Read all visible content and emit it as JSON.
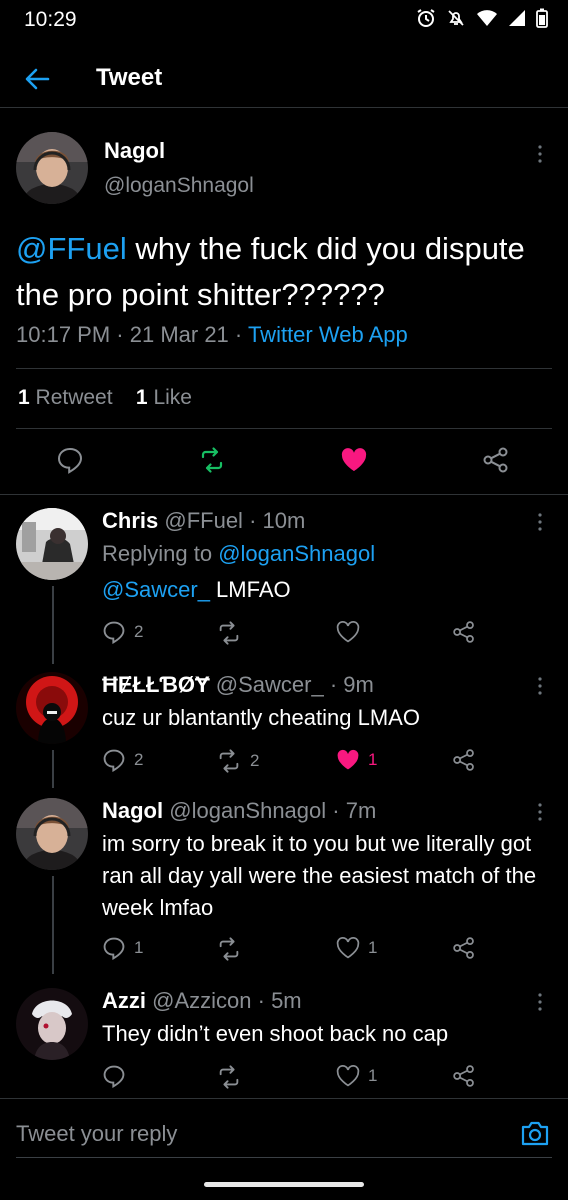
{
  "status_bar": {
    "time": "10:29",
    "icons": [
      "alarm-icon",
      "mute-icon",
      "wifi-icon",
      "signal-icon",
      "battery-icon"
    ]
  },
  "header": {
    "title": "Tweet",
    "back_icon": "arrow-left-icon"
  },
  "main_tweet": {
    "name": "Nagol",
    "handle": "@loganShnagol",
    "mention": "@FFuel",
    "text": " why the fuck did you dispute the pro point shitter??????",
    "time": "10:17 PM",
    "date": "21 Mar 21",
    "source": "Twitter Web App",
    "separator": " · ",
    "retweet_count": "1",
    "retweet_label": "Retweet",
    "like_count": "1",
    "like_label": "Like"
  },
  "replies": [
    {
      "name": "Chris",
      "handle": "@FFuel",
      "time": "10m",
      "replying_to_label": "Replying to ",
      "replying_to": "@loganShnagol",
      "mention": "@Sawcer_",
      "text": " LMFAO",
      "reply_count": "2",
      "retweet_count": "",
      "like_count": "",
      "liked": false
    },
    {
      "name": "ĦɆŁŁƁØɎ",
      "handle": "@Sawcer_",
      "time": "9m",
      "text": "cuz ur blantantly cheating LMAO",
      "reply_count": "2",
      "retweet_count": "2",
      "like_count": "1",
      "liked": true
    },
    {
      "name": "Nagol",
      "handle": "@loganShnagol",
      "time": "7m",
      "text": "im sorry to break it to you but we literally got ran all day yall were the easiest match of the week lmfao",
      "reply_count": "1",
      "retweet_count": "",
      "like_count": "1",
      "liked": false
    },
    {
      "name": "Azzi",
      "handle": "@Azzicon",
      "time": "5m",
      "text": "They didn’t even shoot back no cap",
      "reply_count": "",
      "retweet_count": "",
      "like_count": "1",
      "liked": false
    }
  ],
  "compose": {
    "placeholder": "Tweet your reply",
    "camera_icon": "camera-icon"
  },
  "colors": {
    "accent": "#1da1f2",
    "like": "#f91880",
    "retweet_active": "#17bf63",
    "muted": "#8b8f94"
  }
}
